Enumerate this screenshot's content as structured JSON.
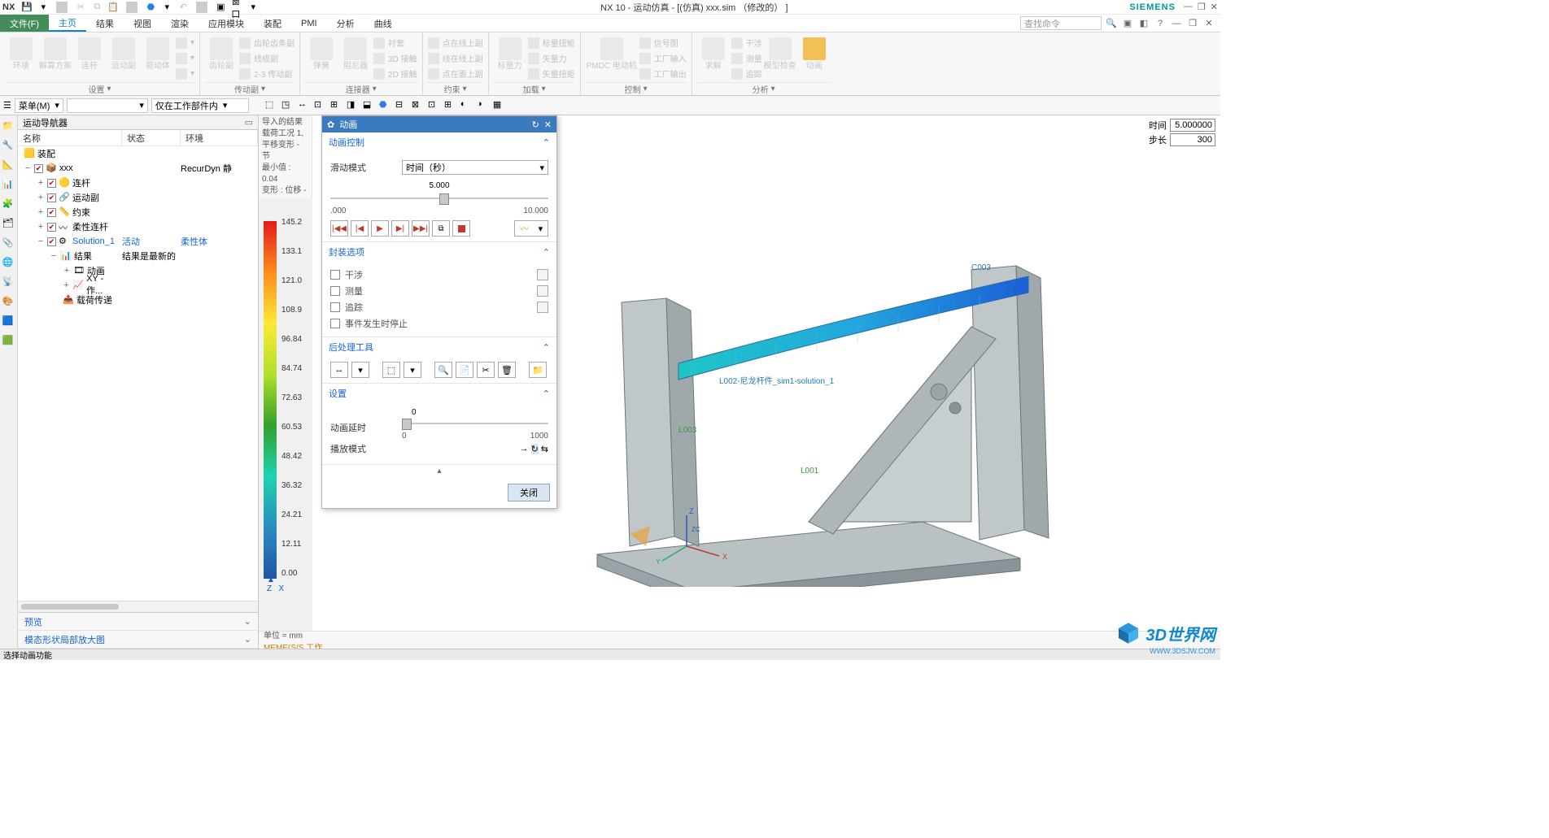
{
  "app": {
    "logo": "NX",
    "title": "NX 10 - 运动仿真 - [(仿真) xxx.sim （修改的） ]",
    "brand": "SIEMENS",
    "window_menu": "窗口"
  },
  "win_btn": {
    "min": "—",
    "max": "❐",
    "close": "✕"
  },
  "tabs": {
    "file": "文件(F)",
    "list": [
      "主页",
      "结果",
      "视图",
      "渲染",
      "应用模块",
      "装配",
      "PMI",
      "分析",
      "曲线"
    ],
    "active": 0
  },
  "search_placeholder": "查找命令",
  "ribbon": {
    "groups": [
      {
        "name": "设置",
        "items": [
          "环境",
          "解算方案",
          "连杆",
          "运动副",
          "驱动体"
        ],
        "sub": [
          "",
          "",
          ""
        ]
      },
      {
        "name": "传动副",
        "items": [
          "齿轮副"
        ],
        "sub": [
          "齿轮齿条副",
          "线缆副",
          "2-3 传动副"
        ]
      },
      {
        "name": "连接器",
        "items": [
          "弹簧",
          "阻尼器",
          ""
        ],
        "sub": [
          "衬套",
          "3D 接触",
          "2D 接触"
        ]
      },
      {
        "name": "约束",
        "items": [
          ""
        ],
        "sub": [
          "点在线上副",
          "线在线上副",
          "点在面上副"
        ]
      },
      {
        "name": "加载",
        "items": [
          "标量力",
          ""
        ],
        "sub": [
          "标量扭矩",
          "矢量力",
          "矢量扭矩"
        ]
      },
      {
        "name": "控制",
        "items": [
          "PMDC 电动机",
          ""
        ],
        "sub": [
          "信号图",
          "工厂输入",
          "工厂输出"
        ]
      },
      {
        "name": "分析",
        "items": [
          "求解",
          "",
          "模型检查",
          "动画"
        ],
        "sub": [
          "干涉",
          "测量",
          "追踪"
        ]
      }
    ]
  },
  "subbar": {
    "menu": "菜单(M)",
    "scope": "仅在工作部件内"
  },
  "navigator": {
    "title": "运动导航器",
    "cols": [
      "名称",
      "状态",
      "环境"
    ],
    "root": "装配",
    "sim": "xxx",
    "env": "RecurDyn 静",
    "items": [
      "连杆",
      "运动副",
      "约束",
      "柔性连杆"
    ],
    "solution": "Solution_1",
    "sol_state": "活动",
    "sol_env": "柔性体",
    "result": "结果",
    "result_state": "结果是最新的",
    "children": [
      "动画",
      "XY - 作...",
      "载荷传递"
    ],
    "preview": "预览",
    "modal": "模态形状局部放大图"
  },
  "sideinfo": [
    "导入的结果",
    "载荷工况 1,",
    "平移变形 - 节",
    "最小值 : 0.04",
    "变形 : 位移 -"
  ],
  "legend": [
    "145.2",
    "133.1",
    "121.0",
    "108.9",
    "96.84",
    "84.74",
    "72.63",
    "60.53",
    "48.42",
    "36.32",
    "24.21",
    "12.11",
    "0.00"
  ],
  "units": "单位 = mm",
  "wm_text": "MEME(S/S 工作",
  "hud": {
    "time_lbl": "时间",
    "time_val": "5.000000",
    "step_lbl": "步长",
    "step_val": "300"
  },
  "dlg": {
    "title": "动画",
    "sec_anim": "动画控制",
    "slide_mode_lbl": "滑动模式",
    "slide_mode_val": "时间（秒）",
    "slider_val": "5.000",
    "slider_min": ".000",
    "slider_max": "10.000",
    "sec_pack": "封装选项",
    "pack": [
      "干涉",
      "测量",
      "追踪",
      "事件发生时停止"
    ],
    "sec_post": "后处理工具",
    "sec_set": "设置",
    "delay_lbl": "动画延时",
    "delay_cur": "0",
    "delay_min": "0",
    "delay_max": "1000",
    "play_lbl": "播放模式",
    "close": "关闭"
  },
  "viewport": {
    "annot": [
      "C003",
      "L002-尼龙杆件_sim1-solution_1",
      "L003",
      "L001"
    ],
    "axes": [
      "X",
      "Y",
      "Z",
      "ZC"
    ]
  },
  "status": "选择动画功能",
  "watermark": "3D世界网",
  "watermark_url": "WWW.3DSJW.COM"
}
